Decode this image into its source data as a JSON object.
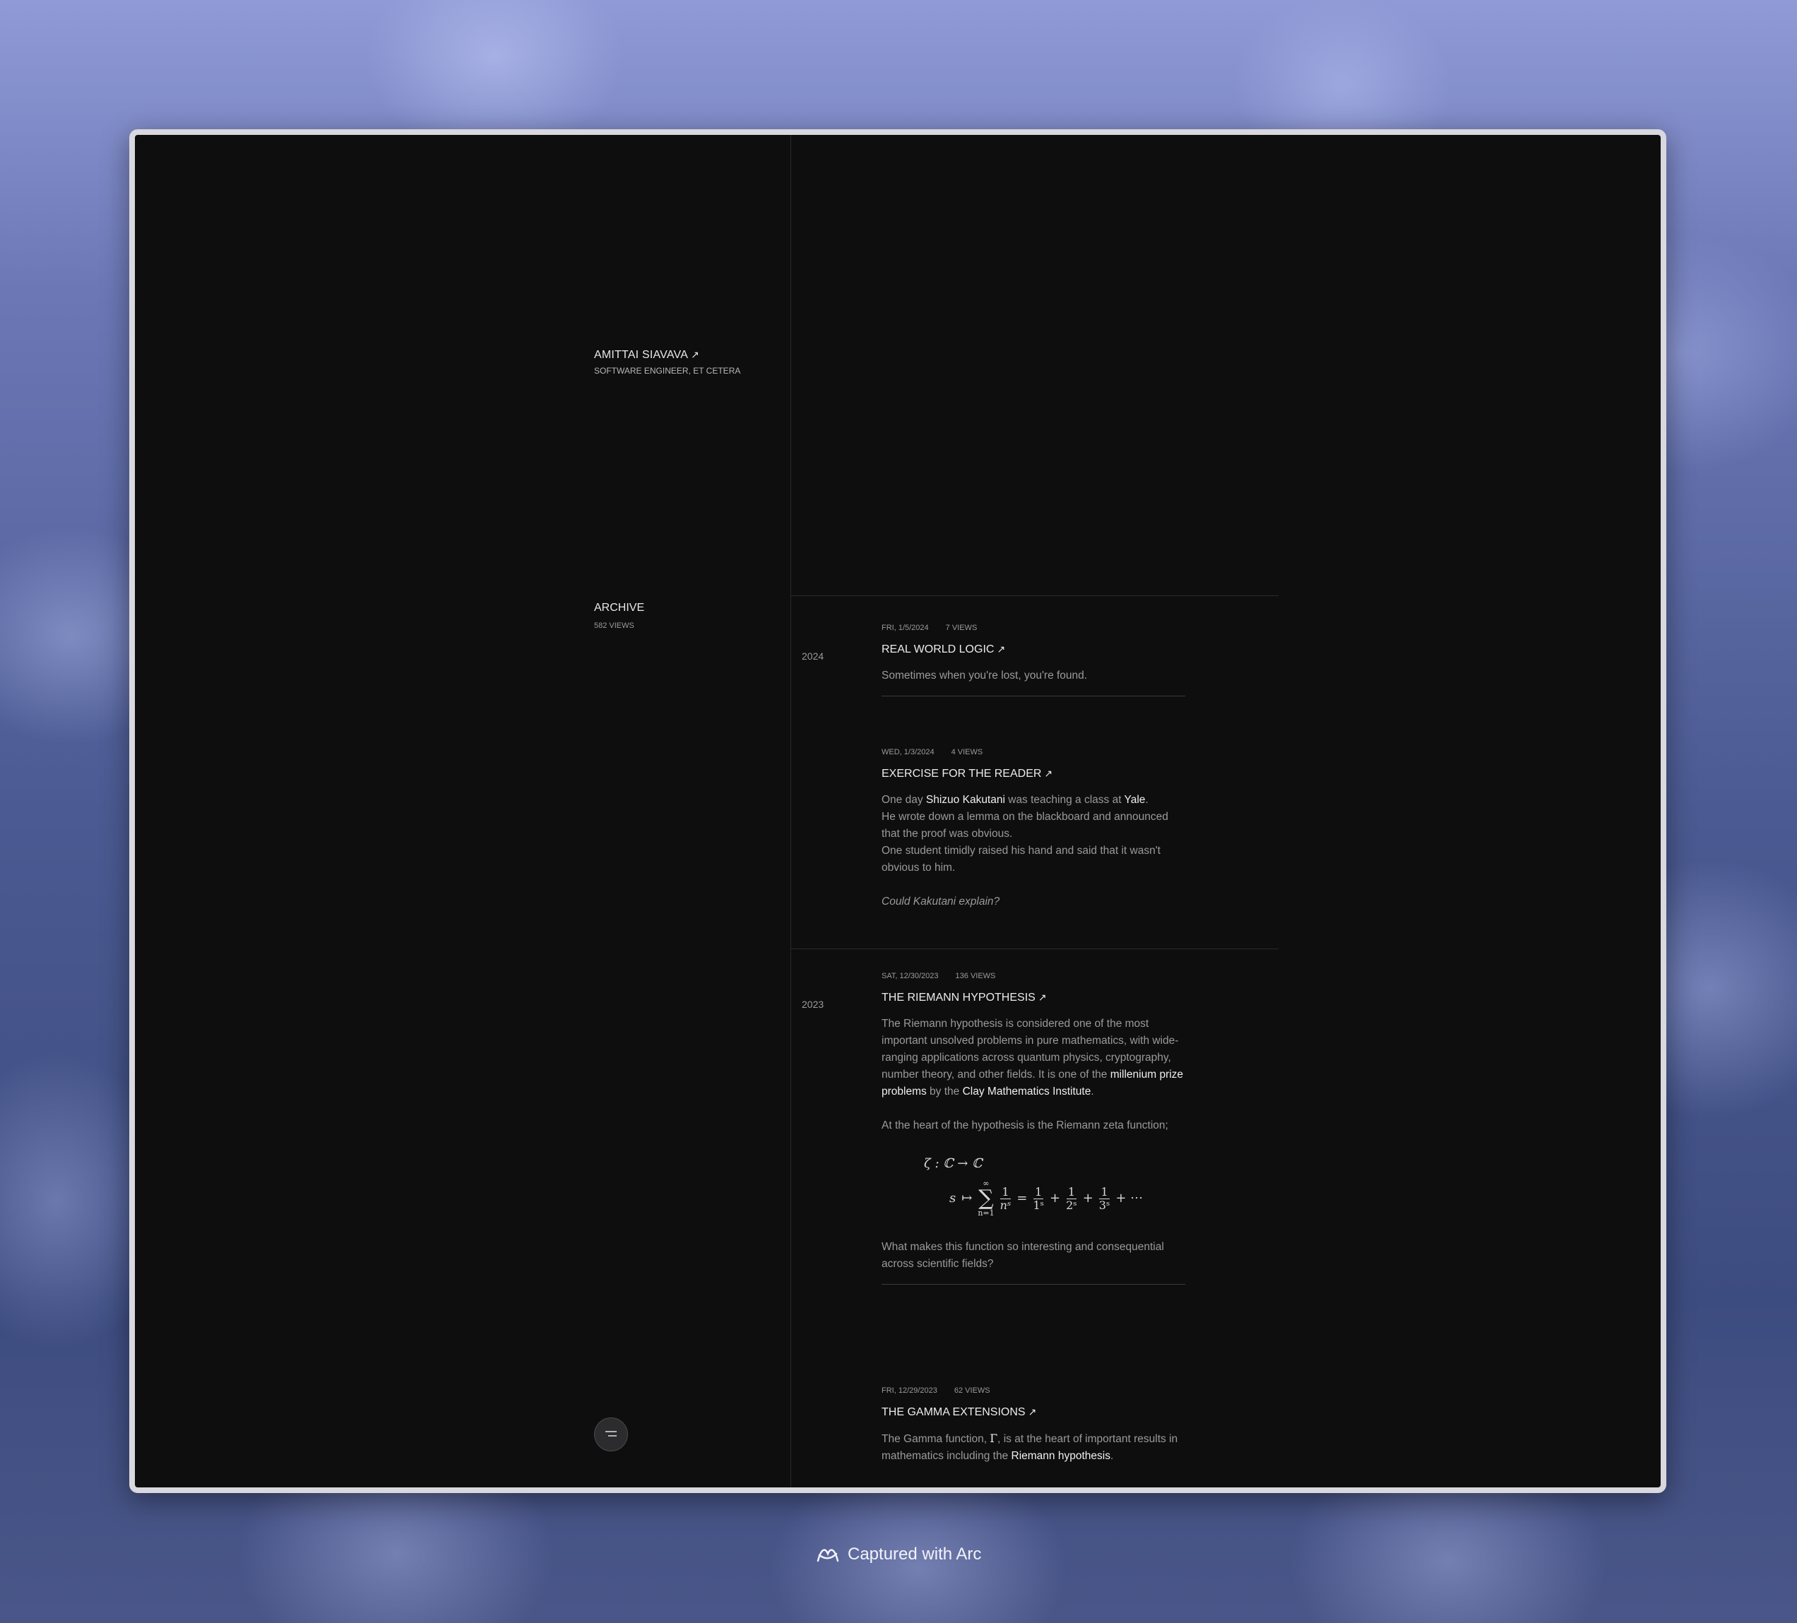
{
  "author": {
    "name": "AMITTAI SIAVAVA",
    "arrow": "↗",
    "role": "SOFTWARE ENGINEER, ET CETERA"
  },
  "archive": {
    "label": "ARCHIVE",
    "views": "582 VIEWS"
  },
  "years": [
    "2024",
    "2023"
  ],
  "posts": [
    {
      "date": "FRI, 1/5/2024",
      "views": "7 VIEWS",
      "title": "REAL WORLD LOGIC",
      "body": "Sometimes when you're lost, you're found."
    },
    {
      "date": "WED, 1/3/2024",
      "views": "4 VIEWS",
      "title": "EXERCISE FOR THE READER",
      "p1a": "One day ",
      "p1b": "Shizuo Kakutani",
      "p1c": " was teaching a class at ",
      "p1d": "Yale",
      "p1e": ".",
      "p2": "He wrote down a lemma on the blackboard and announced that the proof was obvious.",
      "p3": "One student timidly raised his hand and said that it wasn't obvious to him.",
      "p4": "Could Kakutani explain?"
    },
    {
      "date": "SAT, 12/30/2023",
      "views": "136 VIEWS",
      "title": "THE RIEMANN HYPOTHESIS",
      "p1a": "The Riemann hypothesis is considered one of the most important unsolved problems in pure mathematics, with wide-ranging applications across quantum physics, cryptography, number theory, and other fields. It is one of the ",
      "p1b": "millenium prize problems",
      "p1c": " by the ",
      "p1d": "Clay Mathematics Institute",
      "p1e": ".",
      "p2": "At the heart of the hypothesis is the Riemann zeta function;",
      "math_line1": "ζ : ℂ → ℂ",
      "p3": "What makes this function so interesting and consequential across scientific fields?"
    },
    {
      "date": "FRI, 12/29/2023",
      "views": "62 VIEWS",
      "title": "THE GAMMA EXTENSIONS",
      "p1a": "The Gamma function, ",
      "p1b": "Γ",
      "p1c": ", is at the heart of important results in mathematics including the ",
      "p1d": "Riemann hypothesis",
      "p1e": "."
    }
  ],
  "caption": "Captured with Arc"
}
